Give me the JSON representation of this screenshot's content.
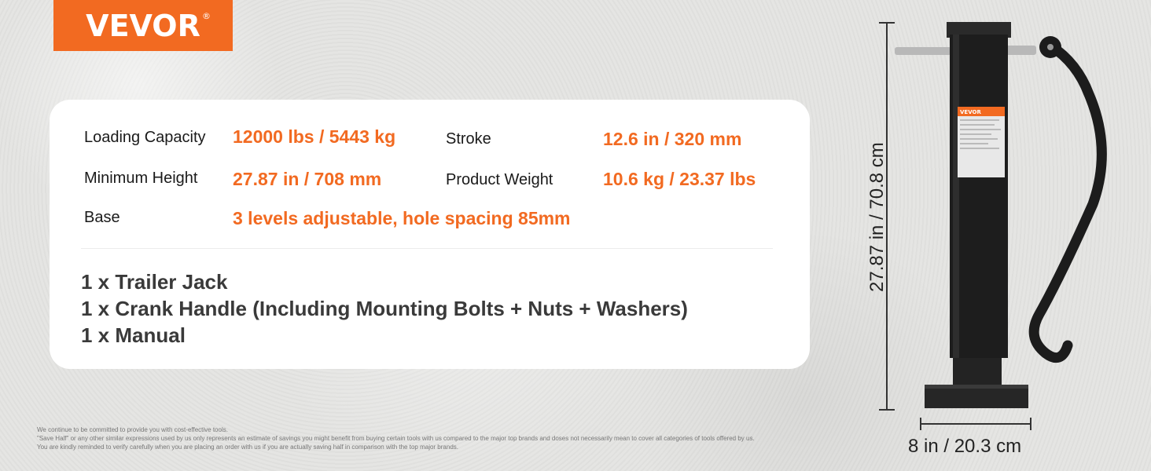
{
  "brand": {
    "name": "VEVOR",
    "reg_mark": "®",
    "color": "#f26a21"
  },
  "specs": {
    "loading_capacity": {
      "label": "Loading Capacity",
      "value": "12000 lbs / 5443 kg"
    },
    "stroke": {
      "label": "Stroke",
      "value": "12.6 in / 320 mm"
    },
    "minimum_height": {
      "label": "Minimum Height",
      "value": "27.87 in / 708 mm"
    },
    "product_weight": {
      "label": "Product Weight",
      "value": "10.6 kg / 23.37 lbs"
    },
    "base": {
      "label": "Base",
      "value": "3 levels adjustable, hole spacing 85mm"
    }
  },
  "package": [
    "1 x Trailer Jack",
    "1 x Crank Handle (Including Mounting Bolts + Nuts + Washers)",
    "1 x Manual"
  ],
  "disclaimer": [
    "We continue to be committed to provide you with cost-effective tools.",
    "\"Save Half\" or any other similar expressions used by us only represents an estimate of savings you might benefit from buying certain tools with us compared to the major top brands and doses not necessarily mean to cover all categories of tools offered by us.",
    "You are kindly reminded to verify carefully when you are placing an order with us if you are actually saving half in comparison with the top major brands."
  ],
  "dimensions": {
    "height": "27.87 in / 70.8 cm",
    "width": "8 in / 20.3 cm"
  },
  "product_label_brand": "VEVOR"
}
